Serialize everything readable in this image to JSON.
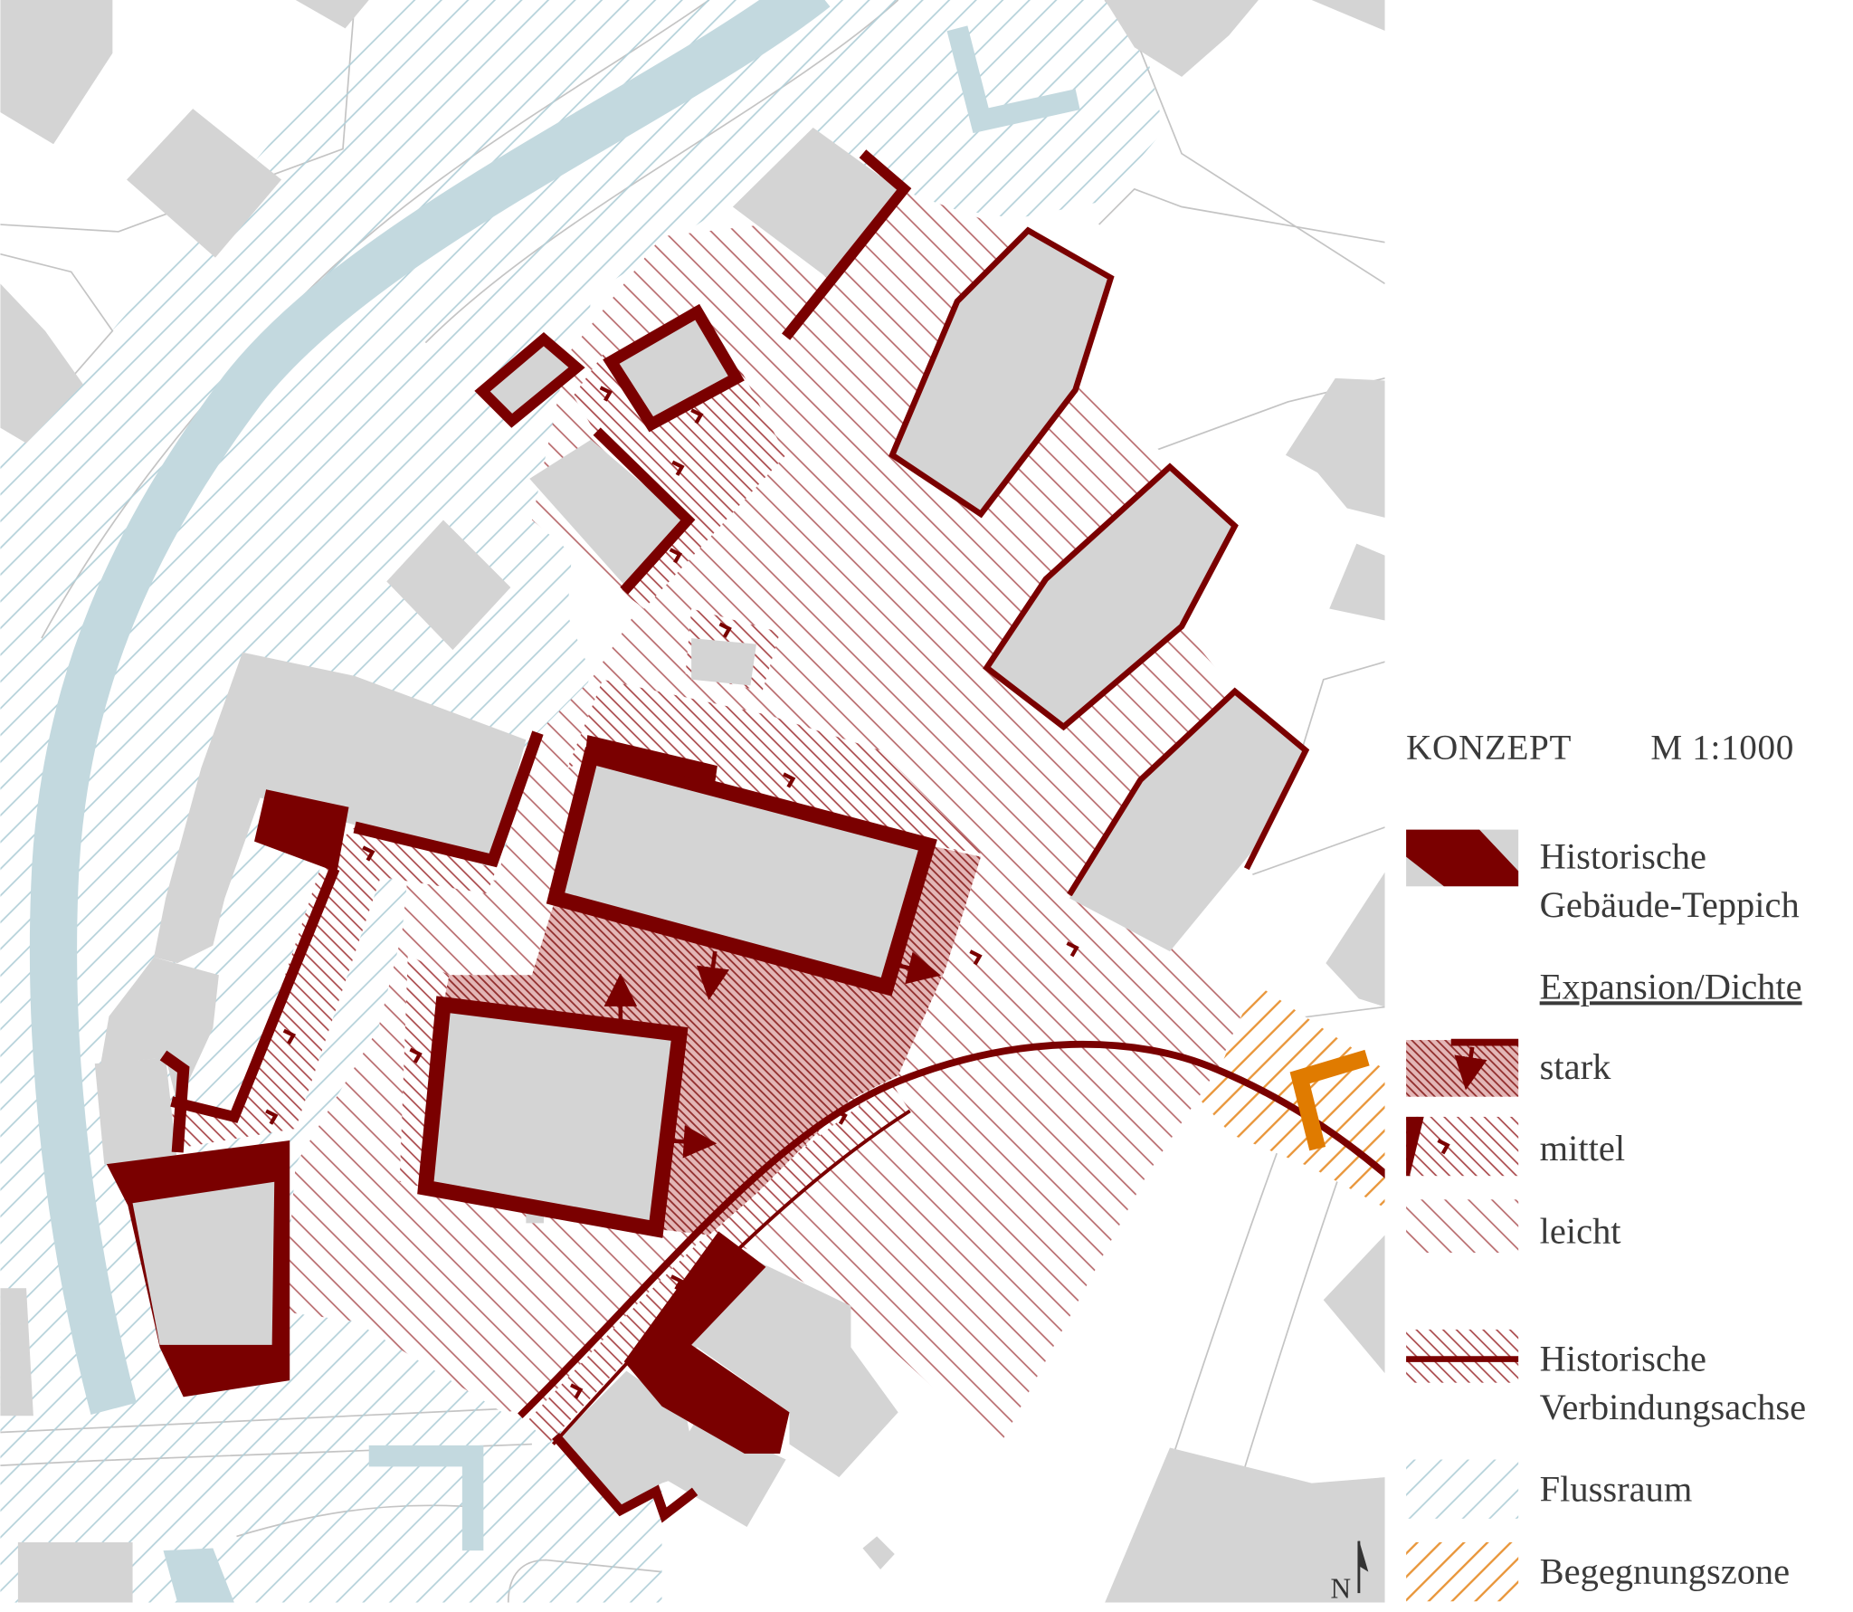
{
  "colors": {
    "historic": "#7a0000",
    "building": "#d4d4d4",
    "river": "#c3d9df",
    "flussraum_hatch": "#b3d0d9",
    "expansion_hatch": "#a9484a",
    "encounter": "#e07b00"
  },
  "legend": {
    "title": "KONZEPT",
    "scale": "M 1:1000",
    "historic_carpet": {
      "line1": "Historische",
      "line2": "Gebäude-Teppich"
    },
    "expansion_heading": "Expansion/Dichte",
    "stark": "stark",
    "mittel": "mittel",
    "leicht": "leicht",
    "axis": {
      "line1": "Historische",
      "line2": "Verbindungsachse"
    },
    "flussraum": "Flussraum",
    "begegnungszone": "Begegnungszone"
  },
  "north_label": "N"
}
